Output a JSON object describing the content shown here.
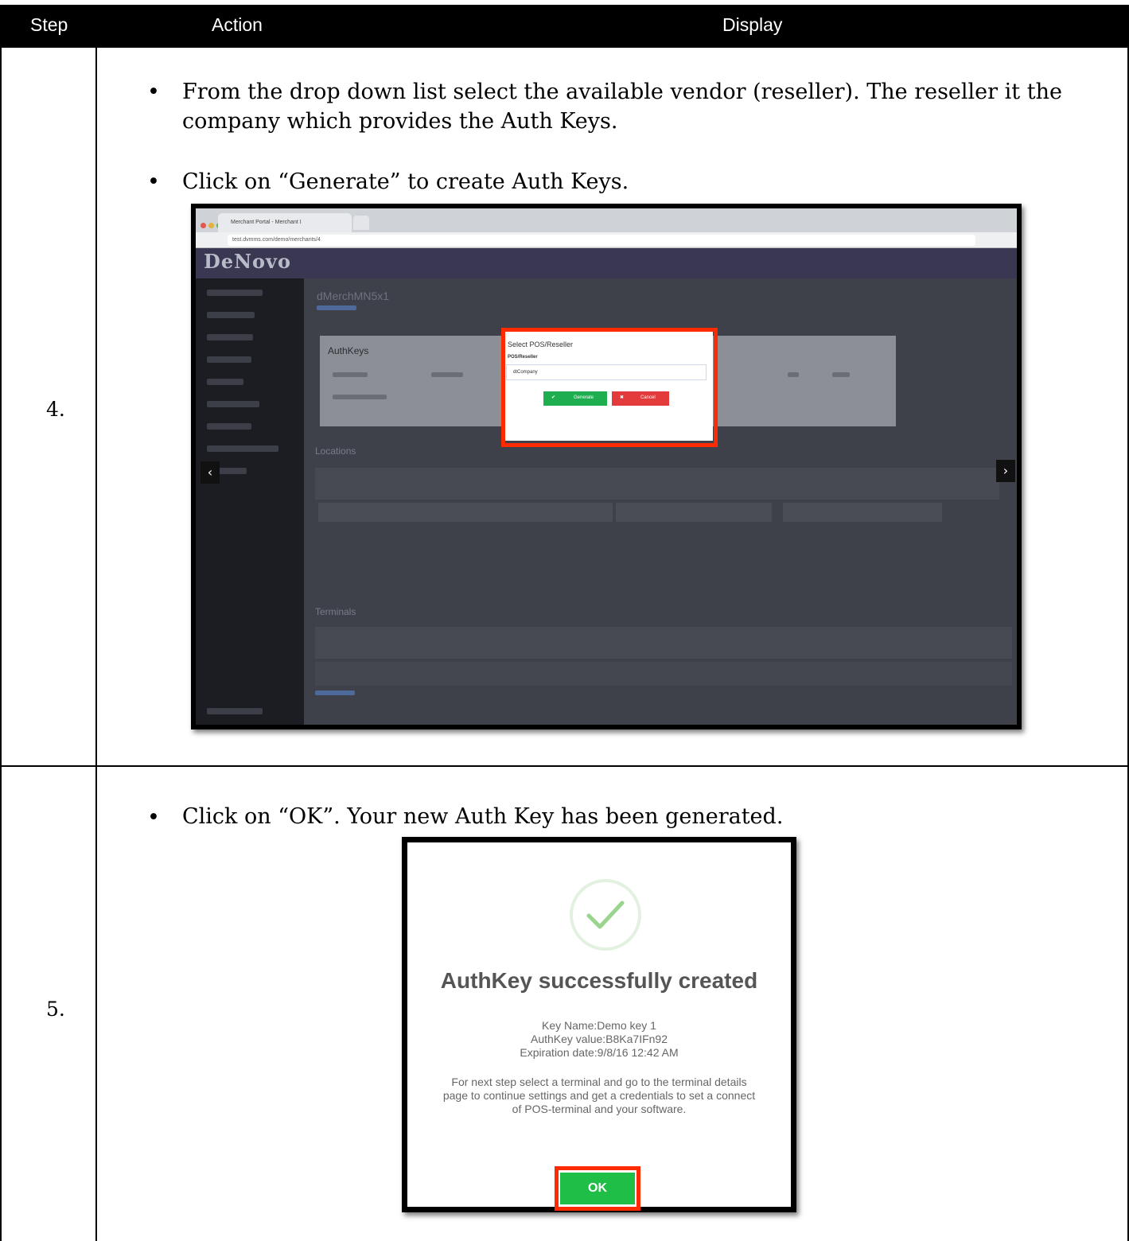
{
  "table": {
    "headers": {
      "step": "Step",
      "action": "Action",
      "display": "Display"
    }
  },
  "rows": [
    {
      "step": "4.",
      "bullets": [
        {
          "symbol": "•",
          "line1": " From the drop down list select the available vendor (reseller).  The reseller it the",
          "line2": "company which provides the Auth Keys."
        },
        {
          "symbol": "•",
          "line1": "Click on “Generate” to create Auth Keys."
        }
      ],
      "screenshot": {
        "tab_title": "Merchant Portal - Merchant I",
        "url": "test.dvmms.com/demo/merchants/4",
        "logo": "DeNovo",
        "page_title": "dMerchMN5x1",
        "panel_title": "AuthKeys",
        "locations_title": "Locations",
        "terminals_title": "Terminals",
        "modal": {
          "title": "Select POS/Reseller",
          "label": "POS/Reseller",
          "selected": "dtCompany",
          "generate_label": "Generate",
          "cancel_label": "Cancel"
        }
      }
    },
    {
      "step": "5.",
      "bullets": [
        {
          "symbol": "•",
          "line1": "Click on “OK”.  Your new Auth Key has been generated."
        }
      ],
      "dialog": {
        "title": "AuthKey successfully created",
        "key_name": "Key Name:Demo key 1",
        "key_value": "AuthKey value:B8Ka7IFn92",
        "expiration": "Expiration date:9/8/16 12:42 AM",
        "note_line1": "For next step select a terminal and go to the terminal details",
        "note_line2": "page to continue settings and get a credentials to set a connect",
        "note_line3": "of POS-terminal and your software.",
        "ok_label": "OK"
      }
    }
  ],
  "colors": {
    "highlight": "#ff2a00",
    "success": "#1fae4f",
    "danger": "#e33b3b"
  }
}
